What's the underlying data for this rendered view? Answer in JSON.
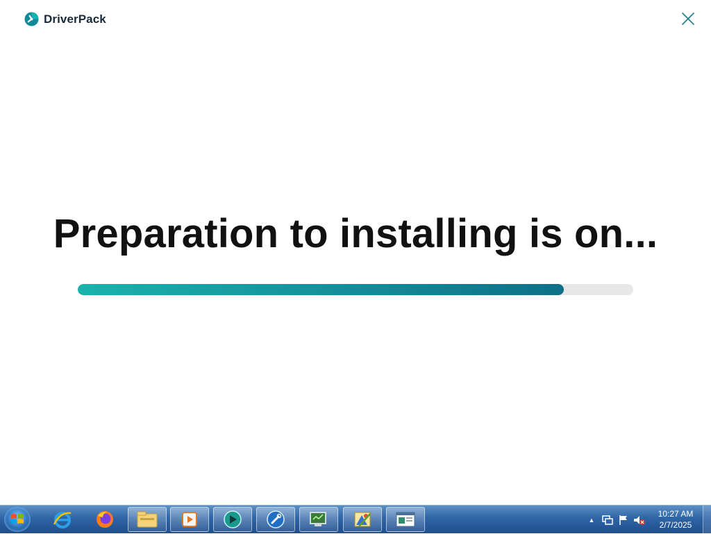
{
  "app": {
    "brand": "DriverPack",
    "headline": "Preparation to installing is on...",
    "progress": 0.875,
    "accent_start": "#19b3ad",
    "accent_end": "#0e6f88",
    "close_icon": "close-icon"
  },
  "taskbar": {
    "start_icon": "windows-start-icon",
    "items": [
      {
        "name": "internet-explorer-icon",
        "open": false
      },
      {
        "name": "firefox-icon",
        "open": false
      },
      {
        "name": "file-explorer-icon",
        "open": true
      },
      {
        "name": "media-player-icon",
        "open": true
      },
      {
        "name": "driverpack-icon",
        "open": true
      },
      {
        "name": "tools-icon",
        "open": true
      },
      {
        "name": "device-manager-icon",
        "open": true
      },
      {
        "name": "paint-icon",
        "open": true
      },
      {
        "name": "document-window-icon",
        "open": true
      }
    ],
    "tray_icons": [
      "show-hidden-icons-icon",
      "network-icon",
      "action-center-flag-icon",
      "volume-muted-icon"
    ],
    "time": "10:27 AM",
    "date": "2/7/2025"
  }
}
